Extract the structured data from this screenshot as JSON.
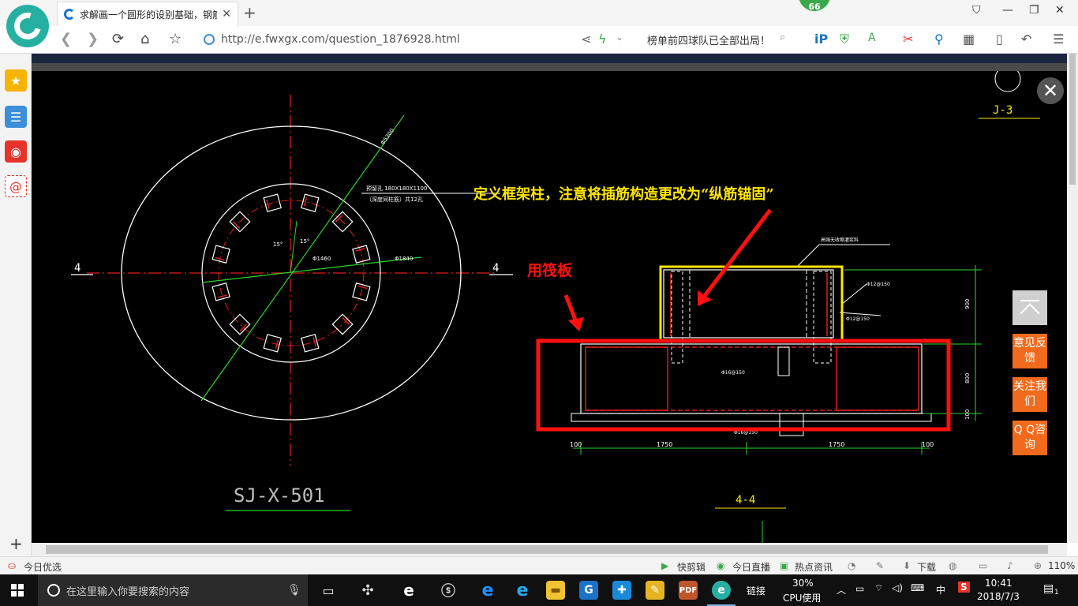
{
  "browser": {
    "tab_title": "求解画一个圆形的设别基础，钢筋",
    "tab_close": "✕",
    "new_tab": "+",
    "badge": "66",
    "url": "http://e.fwxgx.com/question_1876928.html",
    "search_text": "榜单前四球队已全部出局！",
    "window_buttons": [
      "⛉",
      "—",
      "❐",
      "✕"
    ]
  },
  "drawing": {
    "plan_title": "SJ-X-501",
    "section_title": "4-4",
    "section_marker": "4",
    "top_right_label": "J-3",
    "annot_yellow": "定义框架柱，注意将插筋构造更改为“纵筋锚固”",
    "annot_red": "用筏板",
    "plan_note_1": "预留孔 180X180X1100",
    "plan_note_2": "（深度同柱筋）共12孔",
    "plan_dim_outer": "Φ5300",
    "plan_dim_ring": "Φ1840",
    "plan_dim_inner": "Φ1460",
    "plan_angle": "15°",
    "sec_note_top": "高强无收缩灌浆料",
    "sec_rebar_1": "Φ12@150",
    "sec_rebar_2": "Φ12@150",
    "sec_rebar_3": "Φ16@150",
    "sec_rebar_4": "Φ16@150",
    "sec_dim_900": "900",
    "sec_dim_800": "800",
    "sec_dim_100": "100",
    "sec_bottom_dims": [
      "100",
      "1750",
      "1750",
      "100"
    ]
  },
  "floating": {
    "close": "✕",
    "feedback": "意见反馈",
    "follow": "关注我们",
    "qq": "Q Q咨询"
  },
  "statusbar": {
    "today": "今日优选",
    "kuaijianji": "快剪辑",
    "live": "今日直播",
    "news": "热点资讯",
    "download": "下载",
    "zoom": "110%"
  },
  "taskbar": {
    "search_placeholder": "在这里输入你要搜索的内容",
    "link": "链接",
    "cpu_percent": "30%",
    "cpu_label": "CPU使用",
    "ime": "中",
    "time": "10:41",
    "date": "2018/7/3",
    "notif_count": "1"
  },
  "colors": {
    "cad_background": "#000000",
    "cad_line": "#ffffff",
    "cad_axis": "#e01e1e",
    "cad_diag": "#2bd62b",
    "highlight_yellow": "#ffe600",
    "highlight_red": "#ff1010",
    "float_orange": "#f26a1b"
  }
}
